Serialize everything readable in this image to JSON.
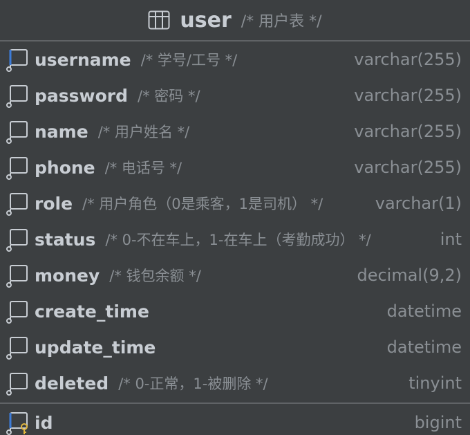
{
  "table": {
    "name": "user",
    "comment": "/* 用户表 */",
    "icon": "table-icon"
  },
  "columns": [
    {
      "name": "username",
      "comment": "/* 学号/工号 */",
      "type": "varchar(255)",
      "icon": "column-index-icon"
    },
    {
      "name": "password",
      "comment": "/* 密码 */",
      "type": "varchar(255)",
      "icon": "column-icon"
    },
    {
      "name": "name",
      "comment": "/* 用户姓名 */",
      "type": "varchar(255)",
      "icon": "column-icon"
    },
    {
      "name": "phone",
      "comment": "/* 电话号 */",
      "type": "varchar(255)",
      "icon": "column-icon"
    },
    {
      "name": "role",
      "comment": "/* 用户角色（0是乘客，1是司机） */",
      "type": "varchar(1)",
      "icon": "column-icon"
    },
    {
      "name": "status",
      "comment": "/* 0-不在车上，1-在车上（考勤成功） */",
      "type": "int",
      "icon": "column-icon"
    },
    {
      "name": "money",
      "comment": "/* 钱包余额 */",
      "type": "decimal(9,2)",
      "icon": "column-icon"
    },
    {
      "name": "create_time",
      "comment": "",
      "type": "datetime",
      "icon": "column-icon"
    },
    {
      "name": "update_time",
      "comment": "",
      "type": "datetime",
      "icon": "column-icon"
    },
    {
      "name": "deleted",
      "comment": "/* 0-正常，1-被删除 */",
      "type": "tinyint",
      "icon": "column-icon"
    }
  ],
  "primary_key": {
    "name": "id",
    "comment": "",
    "type": "bigint",
    "icon": "primary-key-icon"
  },
  "colors": {
    "background": "#3c3f41",
    "text": "#c8cdd3",
    "muted": "#8a8f94",
    "divider": "#606366",
    "index_accent": "#3d7cd9",
    "key_accent": "#e0b53d"
  }
}
